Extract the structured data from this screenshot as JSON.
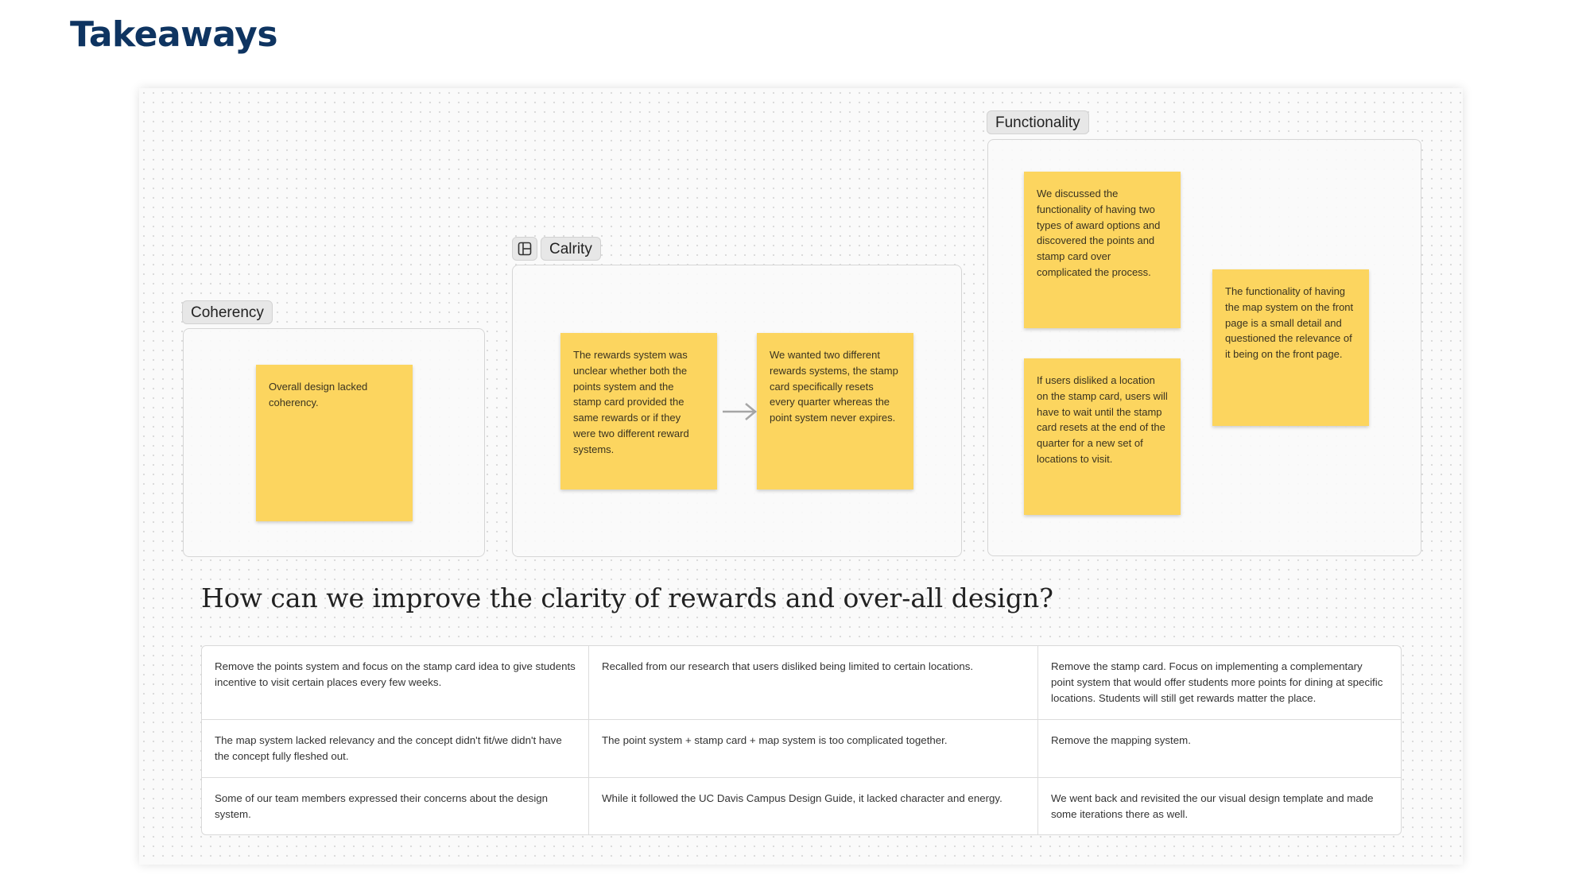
{
  "page": {
    "title": "Takeaways"
  },
  "colors": {
    "title": "#0e3461",
    "sticky_note": "#fcd55f",
    "section_label_bg": "#e7e7e7"
  },
  "board": {
    "sections": {
      "coherency": {
        "label": "Coherency",
        "notes": [
          "Overall design lacked coherency."
        ]
      },
      "clarity": {
        "label": "Calrity",
        "icon": "table-icon",
        "notes": [
          "The rewards system was unclear whether both the points system and the stamp card provided the same rewards or if they were two different reward systems.",
          "We wanted two different rewards systems, the stamp card specifically resets every quarter whereas the point system never expires."
        ]
      },
      "functionality": {
        "label": "Functionality",
        "notes": [
          "We discussed the functionality of having two types of award options and discovered the points and stamp card over complicated the process.",
          "If users disliked a location on the stamp card, users will have to wait until the stamp card resets at the end of the quarter for a new set of locations to visit.",
          "The functionality of having the map system on the front page is a small detail and questioned the relevance of it being on the front page."
        ]
      }
    },
    "question": "How can we improve the clarity of rewards and over-all design?",
    "table": {
      "rows": [
        [
          "Remove the points system and focus on the stamp card idea to give students incentive to visit certain places every few weeks.",
          "Recalled from our research that users disliked being limited to certain locations.",
          "Remove the stamp card. Focus on implementing a complementary point system that would offer students more points for dining at specific locations. Students will still get rewards matter the place."
        ],
        [
          "The map system lacked relevancy and the concept didn't fit/we didn't have the concept fully fleshed out.",
          "The point system + stamp card + map system is too complicated together.",
          "Remove the mapping system."
        ],
        [
          "Some of our team members expressed their concerns about the design system.",
          "While it followed the UC Davis Campus Design Guide, it lacked character and energy.",
          "We went back and revisited the our visual design template and made some iterations there as well."
        ]
      ]
    }
  }
}
